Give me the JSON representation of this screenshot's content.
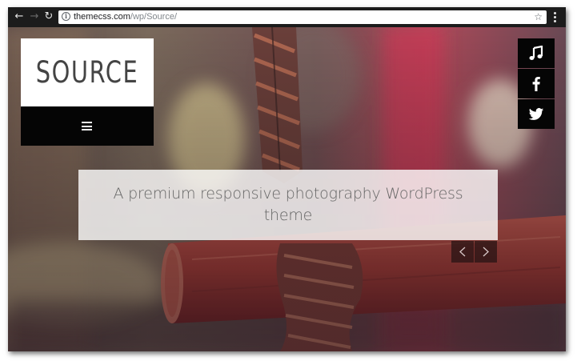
{
  "browser": {
    "url_host": "themecss.com",
    "url_path": "/wp/Source/"
  },
  "site": {
    "logo": "SOURCE",
    "tagline": "A premium responsive photography WordPress theme",
    "social": [
      "music-icon",
      "facebook-icon",
      "twitter-icon"
    ]
  },
  "colors": {
    "panel_black": "#050505",
    "logo_text": "#444444",
    "tagline_text": "#666666",
    "overlay_white": "rgba(255,255,255,0.8)"
  }
}
